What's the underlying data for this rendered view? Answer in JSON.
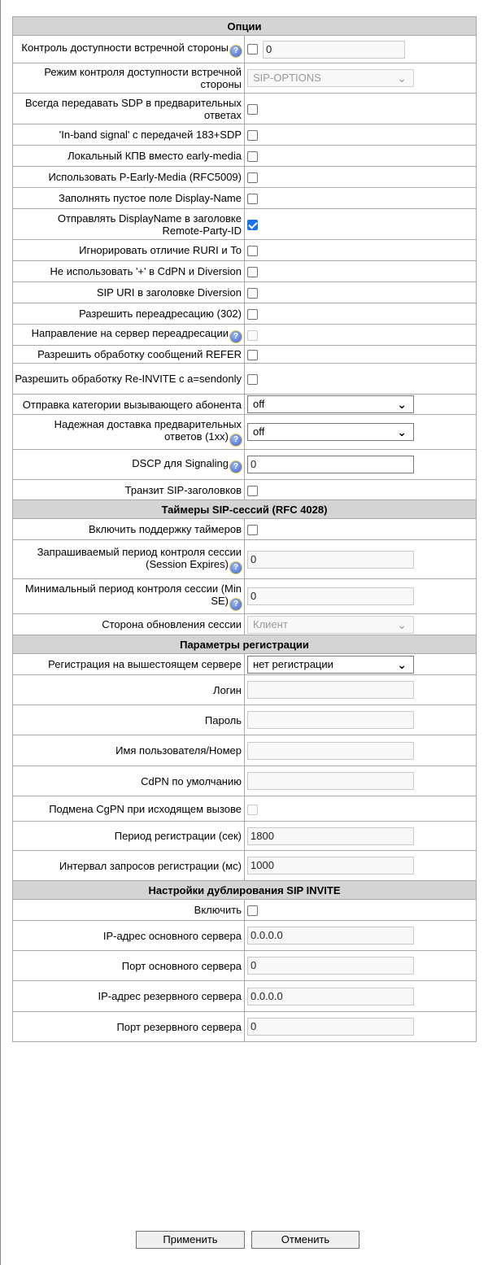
{
  "sections": {
    "options": "Опции",
    "timers": "Таймеры SIP-сессий (RFC 4028)",
    "registration": "Параметры регистрации",
    "duplication": "Настройки дублирования SIP INVITE"
  },
  "options": {
    "availability_control_label": "Контроль доступности встречной стороны",
    "availability_control_value": "0",
    "availability_mode_label": "Режим контроля доступности встречной стороны",
    "availability_mode_value": "SIP-OPTIONS",
    "always_sdp_label": "Всегда передавать SDP в предварительных ответах",
    "inband_label": "'In-band signal' с передачей 183+SDP",
    "local_kpv_label": "Локальный КПВ вместо early-media",
    "p_early_media_label": "Использовать P-Early-Media (RFC5009)",
    "fill_display_name_label": "Заполнять пустое поле Display-Name",
    "send_display_name_label": "Отправлять DisplayName в заголовке Remote-Party-ID",
    "ignore_ruri_label": "Игнорировать отличие RURI и To",
    "no_plus_label": "Не использовать '+' в CdPN и Diversion",
    "sip_uri_div_label": "SIP URI в заголовке Diversion",
    "allow_302_label": "Разрешить переадресацию (302)",
    "redirect_server_label": "Направление на сервер переадресации",
    "allow_refer_label": "Разрешить обработку сообщений REFER",
    "allow_reinvite_label": "Разрешить обработку Re-INVITE с a=sendonly",
    "caller_category_label": "Отправка категории вызывающего абонента",
    "caller_category_value": "off",
    "reliable_1xx_label": "Надежная доставка предварительных ответов (1xx)",
    "reliable_1xx_value": "off",
    "dscp_label": "DSCP для Signaling",
    "dscp_value": "0",
    "transit_headers_label": "Транзит SIP-заголовков"
  },
  "timers": {
    "enable_label": "Включить поддержку таймеров",
    "session_expires_label": "Запрашиваемый период контроля сессии (Session Expires)",
    "session_expires_value": "0",
    "min_se_label": "Минимальный период контроля сессии (Min SE)",
    "min_se_value": "0",
    "refresher_label": "Сторона обновления сессии",
    "refresher_value": "Клиент"
  },
  "registration": {
    "upstream_label": "Регистрация на вышестоящем сервере",
    "upstream_value": "нет регистрации",
    "login_label": "Логин",
    "password_label": "Пароль",
    "username_label": "Имя пользователя/Номер",
    "default_cdpn_label": "CdPN по умолчанию",
    "cgpn_substitution_label": "Подмена CgPN при исходящем вызове",
    "period_label": "Период регистрации (сек)",
    "period_value": "1800",
    "interval_label": "Интервал запросов регистрации (мс)",
    "interval_value": "1000"
  },
  "duplication": {
    "enable_label": "Включить",
    "primary_ip_label": "IP-адрес основного сервера",
    "primary_ip_value": "0.0.0.0",
    "primary_port_label": "Порт основного сервера",
    "primary_port_value": "0",
    "backup_ip_label": "IP-адрес резервного сервера",
    "backup_ip_value": "0.0.0.0",
    "backup_port_label": "Порт резервного сервера",
    "backup_port_value": "0"
  },
  "buttons": {
    "apply": "Применить",
    "cancel": "Отменить"
  },
  "icons": {
    "help": "help-icon",
    "chevron": "chevron-down-icon",
    "help_color": "#3a5fd0",
    "checkbox_checked_color": "#1a73e8"
  },
  "states": {
    "send_display_name_checked": true
  }
}
